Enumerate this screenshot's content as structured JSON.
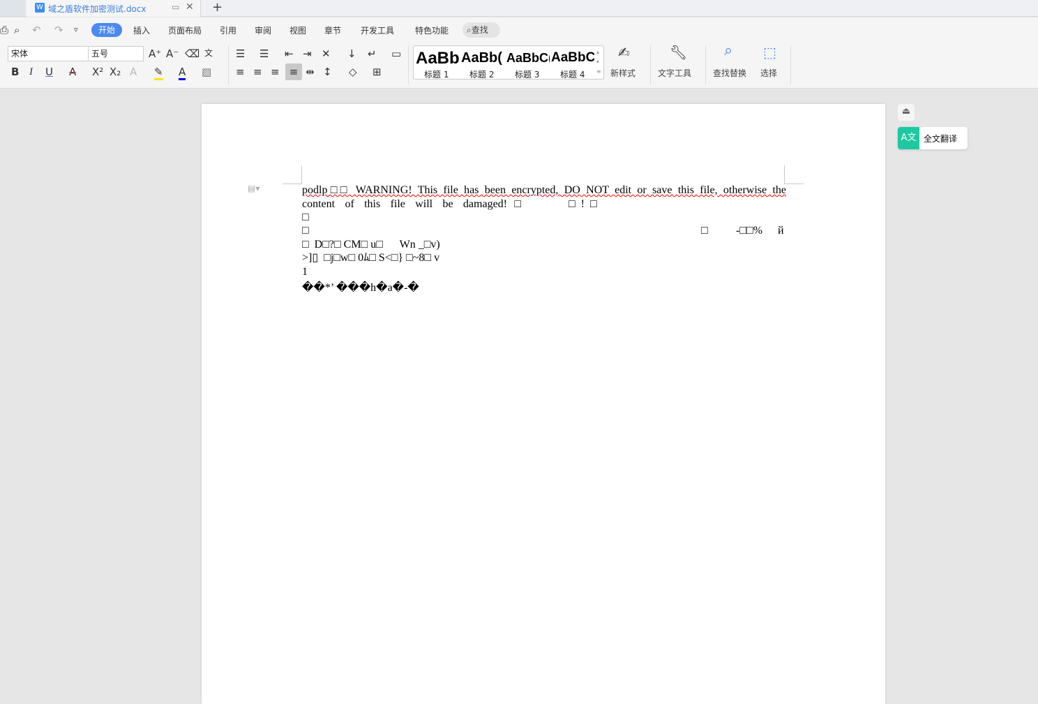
{
  "tabs": [
    {
      "label": ""
    },
    {
      "label": "域之盾软件加密测试.docx",
      "icon": "word-doc-icon"
    }
  ],
  "new_tab": "+",
  "menu": {
    "home": "开始",
    "items": [
      "插入",
      "页面布局",
      "引用",
      "审阅",
      "视图",
      "章节",
      "开发工具",
      "特色功能"
    ],
    "find": "查找"
  },
  "font": {
    "name": "宋体",
    "size": "五号"
  },
  "styles": [
    {
      "preview": "AaBb",
      "label": "标题 1"
    },
    {
      "preview": "AaBb(",
      "label": "标题 2"
    },
    {
      "preview": "AaBbC(",
      "label": "标题 3"
    },
    {
      "preview": "AaBbC",
      "label": "标题 4"
    }
  ],
  "ribbon_buttons": {
    "new_style": "新样式",
    "text_tools": "文字工具",
    "find_replace": "查找替换",
    "select": "选择"
  },
  "side": {
    "translate": "全文翻译"
  },
  "document": {
    "line1": "podlp□□  WARNING! This file has been encrypted, DO NOT edit or save this file, otherwise the",
    "line2": "content of this file will be damaged!□",
    "line2b": "□  !  □",
    "line3": "□",
    "line4a": "□",
    "line4b": "□",
    "line4c": "-□□%",
    "line4d": "й",
    "line5": "□  D□?□ CM□ u□      Wn _□v)",
    "line6": ">]▯  □j□w□ 0ﾑ□ S<□} □~8□ v",
    "line7": "1",
    "line8": "��*’ ���h�a�-�"
  }
}
